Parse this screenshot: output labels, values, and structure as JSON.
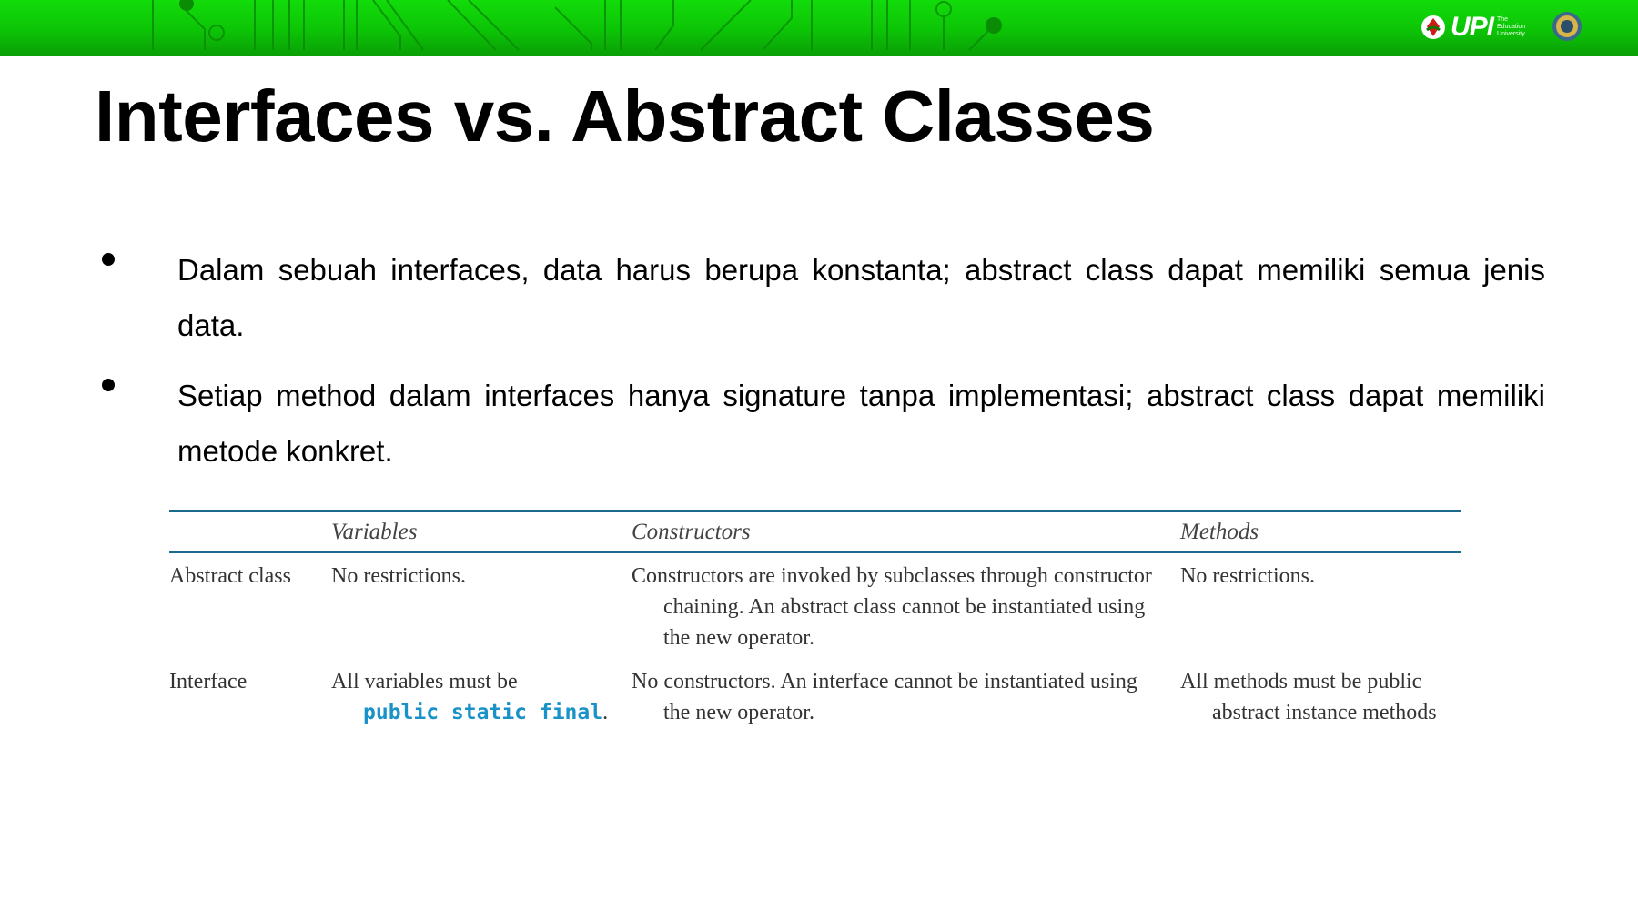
{
  "header": {
    "logo": {
      "text": "UPI",
      "subtitle_lines": [
        "The",
        "Education",
        "University"
      ]
    }
  },
  "slide": {
    "title": "Interfaces vs. Abstract Classes",
    "bullets": [
      "Dalam sebuah interfaces, data harus berupa konstanta; abstract class dapat memiliki semua jenis data.",
      "Setiap method dalam interfaces hanya signature tanpa implementasi; abstract class dapat memiliki metode konkret."
    ]
  },
  "table": {
    "headers": [
      "",
      "Variables",
      "Constructors",
      "Methods"
    ],
    "rows": [
      {
        "label": "Abstract class",
        "variables": "No restrictions.",
        "constructors": "Constructors are invoked by subclasses through constructor chaining. An abstract class cannot be instantiated using the new operator.",
        "methods": "No restrictions."
      },
      {
        "label": "Interface",
        "variables_prefix": "All variables must be",
        "variables_code": "public static final",
        "variables_suffix": ".",
        "constructors": "No constructors. An interface cannot be instantiated using the new operator.",
        "methods": "All methods must be public abstract instance methods"
      }
    ]
  },
  "colors": {
    "header_green": "#0cc406",
    "table_rule": "#1b6a8e",
    "code_blue": "#1992c8"
  }
}
